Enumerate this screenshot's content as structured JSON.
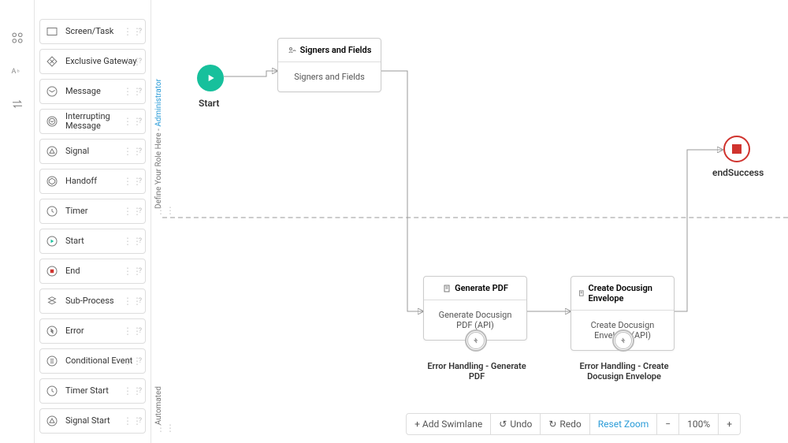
{
  "palette": [
    {
      "label": "Screen/Task",
      "icon": "rect"
    },
    {
      "label": "Exclusive Gateway",
      "icon": "diamond-x"
    },
    {
      "label": "Message",
      "icon": "envelope"
    },
    {
      "label": "Interrupting Message",
      "icon": "envelope-ring"
    },
    {
      "label": "Signal",
      "icon": "triangle"
    },
    {
      "label": "Handoff",
      "icon": "hexagon"
    },
    {
      "label": "Timer",
      "icon": "clock"
    },
    {
      "label": "Start",
      "icon": "play"
    },
    {
      "label": "End",
      "icon": "stop"
    },
    {
      "label": "Sub-Process",
      "icon": "layers"
    },
    {
      "label": "Error",
      "icon": "bolt"
    },
    {
      "label": "Conditional Event",
      "icon": "cond"
    },
    {
      "label": "Timer Start",
      "icon": "clockstart"
    },
    {
      "label": "Signal Start",
      "icon": "signalstart"
    }
  ],
  "lanes": {
    "role_text": "Define Your Role Here - ",
    "role_admin": "Administrator",
    "automated": "Automated"
  },
  "nodes": {
    "start": {
      "label": "Start"
    },
    "signers": {
      "title": "Signers and Fields",
      "body": "Signers and Fields"
    },
    "genpdf": {
      "title": "Generate PDF",
      "body": "Generate Docusign PDF (API)",
      "error_label": "Error Handling - Generate PDF"
    },
    "envelope": {
      "title": "Create Docusign Envelope",
      "body": "Create Docusign Envelope (API)",
      "error_label": "Error Handling - Create Docusign Envelope"
    },
    "end": {
      "label": "endSuccess"
    }
  },
  "toolbar": {
    "add_swimlane": "+ Add Swimlane",
    "undo": "Undo",
    "redo": "Redo",
    "reset": "Reset Zoom",
    "zoom_out": "−",
    "zoom_level": "100%",
    "zoom_in": "+"
  },
  "colors": {
    "accent_green": "#17c09c",
    "danger_red": "#d0332e",
    "link_blue": "#2b9cd8"
  }
}
